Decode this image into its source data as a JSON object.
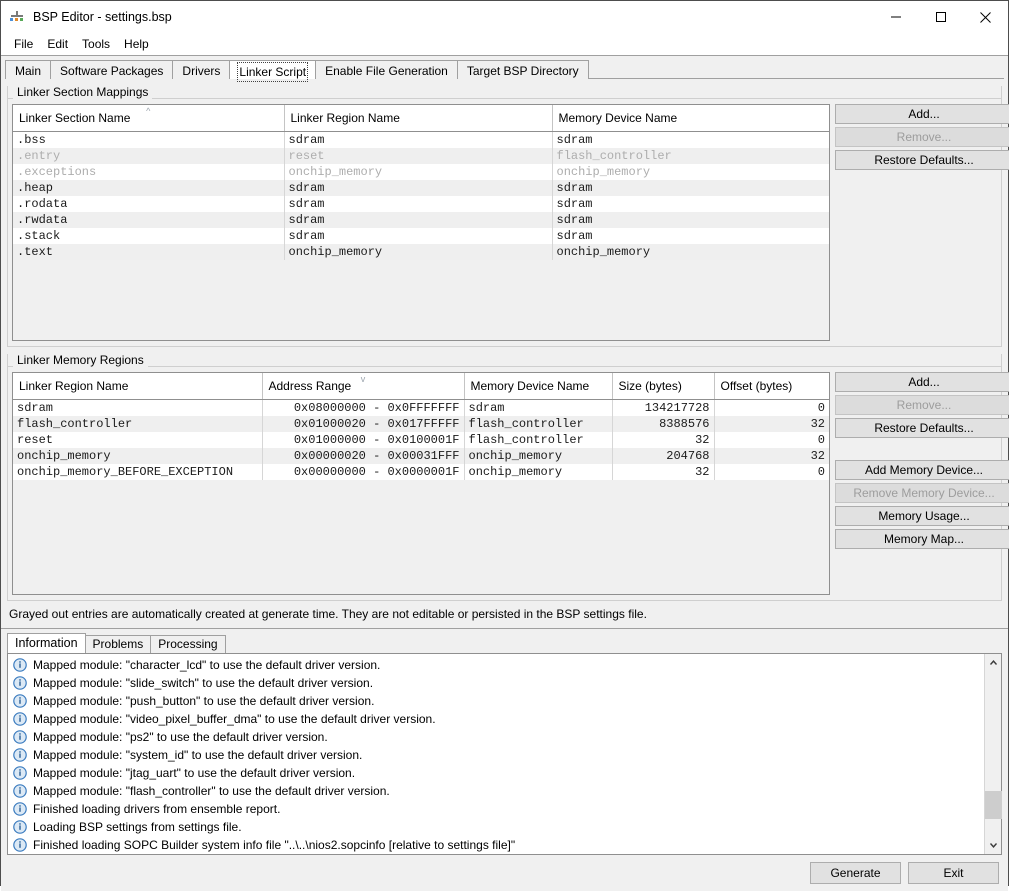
{
  "window": {
    "title": "BSP Editor - settings.bsp",
    "app_icon": "bsp-editor-icon",
    "controls": {
      "minimize": "minimize-icon",
      "maximize": "maximize-icon",
      "close": "close-icon"
    }
  },
  "menubar": {
    "items": [
      {
        "label": "File"
      },
      {
        "label": "Edit"
      },
      {
        "label": "Tools"
      },
      {
        "label": "Help"
      }
    ]
  },
  "tabs": [
    {
      "label": "Main",
      "active": false
    },
    {
      "label": "Software Packages",
      "active": false
    },
    {
      "label": "Drivers",
      "active": false
    },
    {
      "label": "Linker Script",
      "active": true
    },
    {
      "label": "Enable File Generation",
      "active": false
    },
    {
      "label": "Target BSP Directory",
      "active": false
    }
  ],
  "section_mappings": {
    "group_title": "Linker Section Mappings",
    "columns": [
      {
        "label": "Linker Section Name",
        "sort": "asc"
      },
      {
        "label": "Linker Region Name",
        "sort": ""
      },
      {
        "label": "Memory Device Name",
        "sort": ""
      }
    ],
    "rows": [
      {
        "section": ".bss",
        "region": "sdram",
        "device": "sdram",
        "grayed": false
      },
      {
        "section": ".entry",
        "region": "reset",
        "device": "flash_controller",
        "grayed": true
      },
      {
        "section": ".exceptions",
        "region": "onchip_memory",
        "device": "onchip_memory",
        "grayed": true
      },
      {
        "section": ".heap",
        "region": "sdram",
        "device": "sdram",
        "grayed": false
      },
      {
        "section": ".rodata",
        "region": "sdram",
        "device": "sdram",
        "grayed": false
      },
      {
        "section": ".rwdata",
        "region": "sdram",
        "device": "sdram",
        "grayed": false
      },
      {
        "section": ".stack",
        "region": "sdram",
        "device": "sdram",
        "grayed": false
      },
      {
        "section": ".text",
        "region": "onchip_memory",
        "device": "onchip_memory",
        "grayed": false
      }
    ],
    "buttons": [
      {
        "label": "Add...",
        "enabled": true
      },
      {
        "label": "Remove...",
        "enabled": false
      },
      {
        "label": "Restore Defaults...",
        "enabled": true
      }
    ]
  },
  "memory_regions": {
    "group_title": "Linker Memory Regions",
    "columns": [
      {
        "label": "Linker Region Name",
        "sort": ""
      },
      {
        "label": "Address Range",
        "sort": "desc"
      },
      {
        "label": "Memory Device Name",
        "sort": ""
      },
      {
        "label": "Size (bytes)",
        "sort": ""
      },
      {
        "label": "Offset (bytes)",
        "sort": ""
      }
    ],
    "rows": [
      {
        "region": "sdram",
        "range": "0x08000000 - 0x0FFFFFFF",
        "device": "sdram",
        "size": "134217728",
        "offset": "0"
      },
      {
        "region": "flash_controller",
        "range": "0x01000020 - 0x017FFFFF",
        "device": "flash_controller",
        "size": "8388576",
        "offset": "32"
      },
      {
        "region": "reset",
        "range": "0x01000000 - 0x0100001F",
        "device": "flash_controller",
        "size": "32",
        "offset": "0"
      },
      {
        "region": "onchip_memory",
        "range": "0x00000020 - 0x00031FFF",
        "device": "onchip_memory",
        "size": "204768",
        "offset": "32"
      },
      {
        "region": "onchip_memory_BEFORE_EXCEPTION",
        "range": "0x00000000 - 0x0000001F",
        "device": "onchip_memory",
        "size": "32",
        "offset": "0"
      }
    ],
    "buttons": [
      {
        "label": "Add...",
        "enabled": true,
        "gap": false
      },
      {
        "label": "Remove...",
        "enabled": false,
        "gap": false
      },
      {
        "label": "Restore Defaults...",
        "enabled": true,
        "gap": false
      },
      {
        "label": "Add Memory Device...",
        "enabled": true,
        "gap": true
      },
      {
        "label": "Remove Memory Device...",
        "enabled": false,
        "gap": false
      },
      {
        "label": "Memory Usage...",
        "enabled": true,
        "gap": false
      },
      {
        "label": "Memory Map...",
        "enabled": true,
        "gap": false
      }
    ]
  },
  "note": "Grayed out entries are automatically created at generate time. They are not editable or persisted in the BSP settings file.",
  "console": {
    "tabs": [
      {
        "label": "Information",
        "active": true
      },
      {
        "label": "Problems",
        "active": false
      },
      {
        "label": "Processing",
        "active": false
      }
    ],
    "messages": [
      {
        "icon": "info-icon",
        "text": "Mapped module: \"character_lcd\" to use the default driver version."
      },
      {
        "icon": "info-icon",
        "text": "Mapped module: \"slide_switch\" to use the default driver version."
      },
      {
        "icon": "info-icon",
        "text": "Mapped module: \"push_button\" to use the default driver version."
      },
      {
        "icon": "info-icon",
        "text": "Mapped module: \"video_pixel_buffer_dma\" to use the default driver version."
      },
      {
        "icon": "info-icon",
        "text": "Mapped module: \"ps2\" to use the default driver version."
      },
      {
        "icon": "info-icon",
        "text": "Mapped module: \"system_id\" to use the default driver version."
      },
      {
        "icon": "info-icon",
        "text": "Mapped module: \"jtag_uart\" to use the default driver version."
      },
      {
        "icon": "info-icon",
        "text": "Mapped module: \"flash_controller\" to use the default driver version."
      },
      {
        "icon": "info-icon",
        "text": "Finished loading drivers from ensemble report."
      },
      {
        "icon": "info-icon",
        "text": "Loading BSP settings from settings file."
      },
      {
        "icon": "info-icon",
        "text": "Finished loading SOPC Builder system info file \"..\\..\\nios2.sopcinfo [relative to settings file]\""
      }
    ],
    "scrollbar": {
      "up_arrow": "chevron-up-icon",
      "down_arrow": "chevron-down-icon",
      "thumb_position_percent": 72
    }
  },
  "footer": {
    "buttons": [
      {
        "label": "Generate"
      },
      {
        "label": "Exit"
      }
    ]
  },
  "colors": {
    "window_bg": "#f0f0f0",
    "grid_alt_row": "#efefef",
    "grayed_text": "#adadad",
    "info_blue": "#3a7bbf",
    "button_face": "#e1e1e1"
  }
}
